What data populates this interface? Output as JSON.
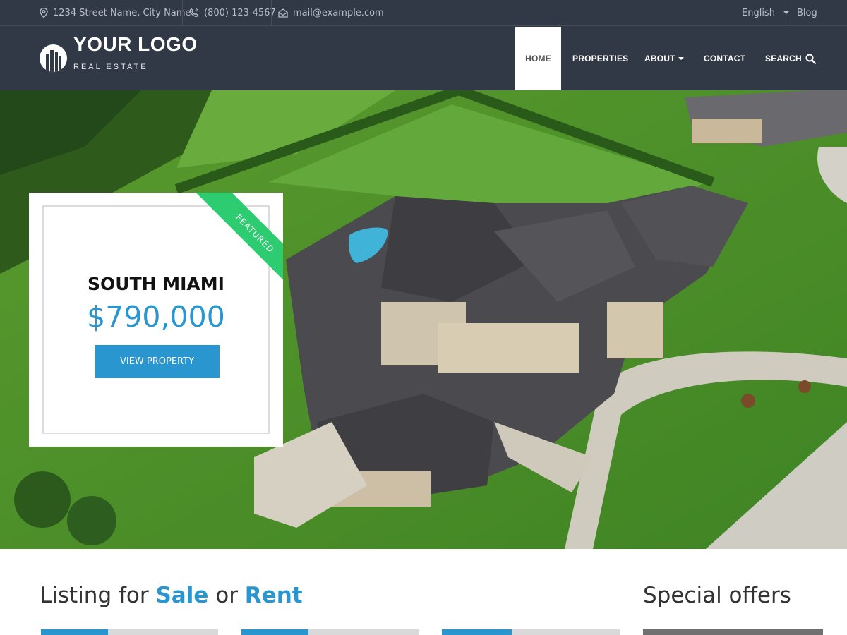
{
  "topbar": {
    "address": "1234 Street Name, City Name",
    "phone": "(800) 123-4567",
    "email": "mail@example.com",
    "language": "English",
    "blog": "Blog"
  },
  "brand": {
    "title": "YOUR LOGO",
    "subtitle": "REAL ESTATE"
  },
  "nav": {
    "home": "HOME",
    "properties": "PROPERTIES",
    "about": "ABOUT",
    "contact": "CONTACT",
    "search": "SEARCH",
    "active": "HOME"
  },
  "featured": {
    "ribbon": "FEATURED",
    "title": "SOUTH MIAMI",
    "price": "$790,000",
    "button": "VIEW PROPERTY"
  },
  "listing": {
    "prefix": "Listing for ",
    "sale": "Sale",
    "or": " or ",
    "rent": "Rent"
  },
  "offers": {
    "title": "Special offers"
  },
  "colors": {
    "header_bg": "#323946",
    "accent": "#2a96cf",
    "ribbon": "#2ecc71"
  }
}
